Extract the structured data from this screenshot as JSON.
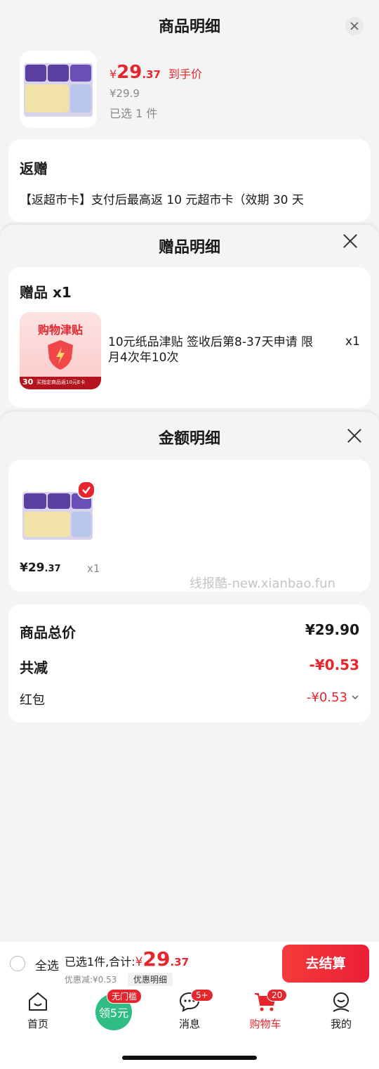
{
  "goods_sheet": {
    "title": "商品明细",
    "price_symbol": "¥",
    "price_int": "29",
    "price_dec": ".37",
    "price_tag": "到手价",
    "orig_price": "¥29.9",
    "selected": "已选 1 件"
  },
  "rebate": {
    "title": "返赠",
    "text": "【返超市卡】支付后最高返 10 元超市卡（效期 30 天"
  },
  "gift_sheet": {
    "title": "赠品明细",
    "section": "赠品 x1",
    "coupon_title": "购物津贴",
    "coupon_tag": "30",
    "coupon_bottom": "买指定商品返10元E卡",
    "desc": "10元纸品津贴 签收后第8-37天申请 限月4次年10次",
    "qty": "x1"
  },
  "amount_sheet": {
    "title": "金额明细",
    "item_price": "¥29.37",
    "item_price_int": "¥29",
    "item_price_dec": ".37",
    "item_qty": "x1",
    "watermark": "线报酷-new.xianbao.fun"
  },
  "summary": {
    "total_label": "商品总价",
    "total_value": "¥29.90",
    "reduce_label": "共减",
    "reduce_value": "-¥0.53",
    "redpack_label": "红包",
    "redpack_value": "-¥0.53"
  },
  "bottom_bar": {
    "select_all": "全选",
    "selected_total": "已选1件,合计:",
    "total_symbol": "¥",
    "total_int": "29",
    "total_dec": ".37",
    "discount": "优惠减:¥0.53",
    "discount_btn": "优惠明细",
    "checkout": "去结算"
  },
  "nav": {
    "home": "首页",
    "coupon_badge": "无门槛",
    "coupon": "领5元",
    "messages": "消息",
    "messages_badge": "5+",
    "cart": "购物车",
    "cart_badge": "20",
    "me": "我的"
  },
  "colors": {
    "accent": "#e6252c",
    "checkout": "#f0262f",
    "coupon_green": "#2fbd85"
  }
}
